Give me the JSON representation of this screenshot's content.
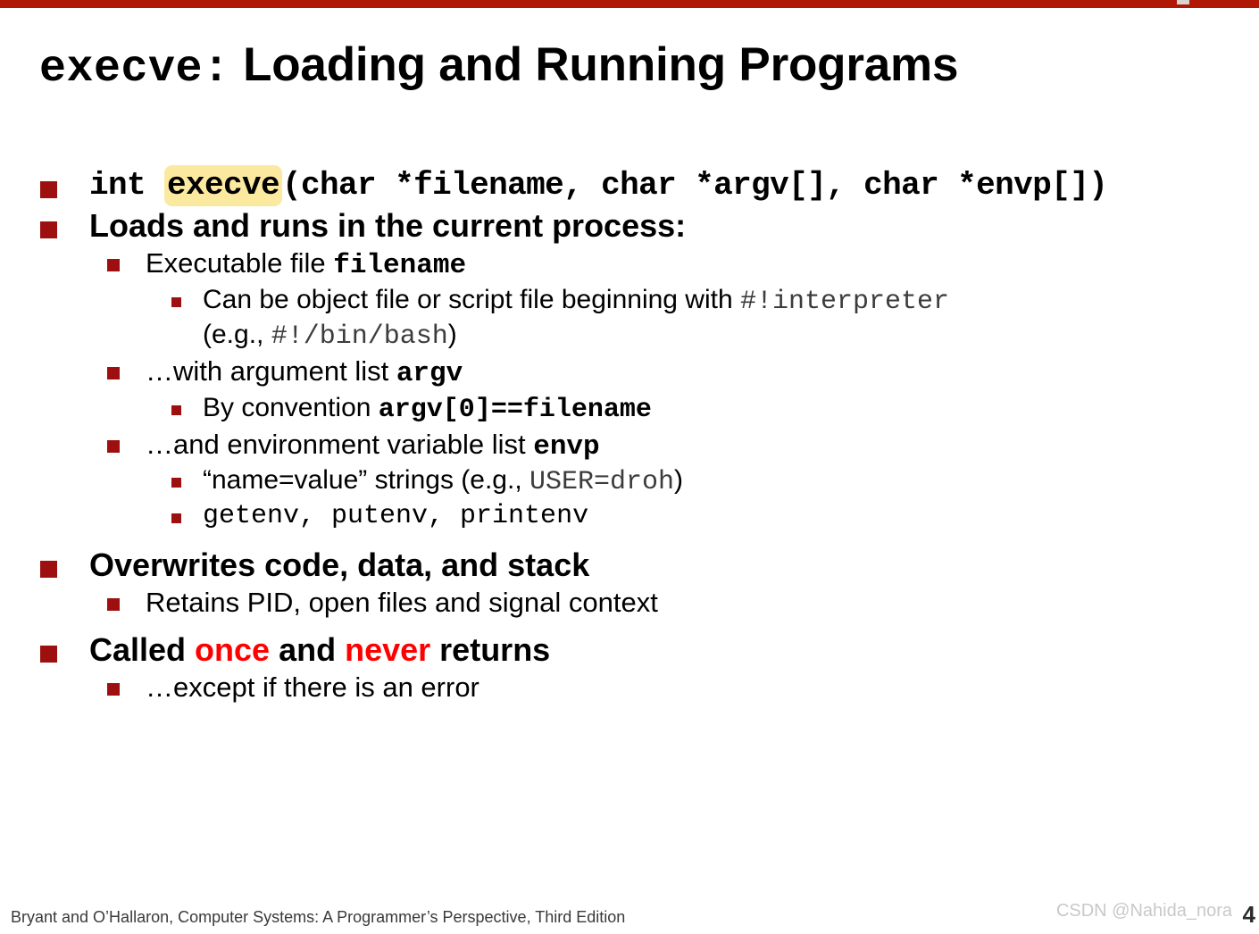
{
  "slide": {
    "title_code": "execve:",
    "title_rest": " Loading and Running Programs",
    "accent_color": "#B01704",
    "bullet_color": "#9E1010",
    "highlight_color": "#FCE9A0",
    "emphasis_color": "#FF0000"
  },
  "signature": {
    "pre": "int ",
    "func": "execve",
    "post": "(char *filename, char *argv[], char *envp[])"
  },
  "bullets": {
    "loads_and_runs": "Loads and runs in the current process:",
    "executable_file_pre": "Executable  file ",
    "executable_file_code": "filename",
    "can_be_object_pre": "Can be object file or script file beginning with ",
    "can_be_object_code": "#!interpreter",
    "can_be_object_eg_pre": "(e.g., ",
    "can_be_object_eg_code": "#!/bin/bash",
    "can_be_object_eg_post": ")",
    "with_argument_list_pre": "…with argument list ",
    "with_argument_list_code": "argv",
    "by_convention_pre": "By convention ",
    "by_convention_code": "argv[0]==filename",
    "and_environment_pre": "…and  environment variable list  ",
    "and_environment_code": "envp",
    "name_value_pre": "“name=value” strings (e.g., ",
    "name_value_code": "USER=droh",
    "name_value_post": ")",
    "env_funcs_code": "getenv, putenv, printenv",
    "overwrites": "Overwrites code, data, and stack",
    "retains_pid": "Retains PID, open files and signal context",
    "called_once_pre": "Called ",
    "called_once_em1": "once",
    "called_once_mid": " and ",
    "called_once_em2": "never",
    "called_once_post": " returns",
    "except_error": "…except if there is an error"
  },
  "footer": {
    "attribution": "Bryant and O’Hallaron, Computer Systems: A Programmer’s Perspective, Third Edition",
    "page_number": "4",
    "watermark": "CSDN @Nahida_nora"
  }
}
